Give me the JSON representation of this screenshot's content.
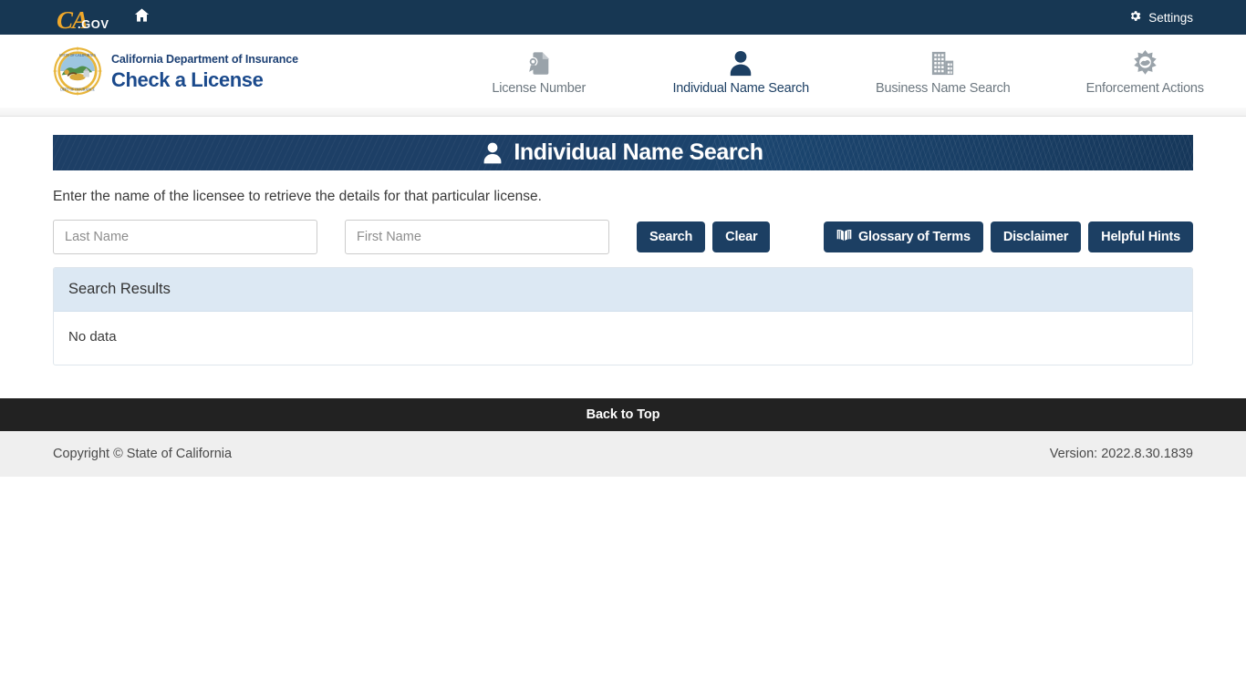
{
  "topbar": {
    "logo_mark": "CA",
    "logo_suffix": ".GOV",
    "home_icon": "home-icon",
    "settings_label": "Settings",
    "settings_icon": "gear-icon",
    "background": "#173753"
  },
  "brand": {
    "seal_icon": "california-state-seal",
    "department": "California Department of Insurance",
    "app_title": "Check a License"
  },
  "nav": {
    "items": [
      {
        "label": "License Number",
        "icon": "license-document-icon",
        "active": false
      },
      {
        "label": "Individual Name Search",
        "icon": "person-icon",
        "active": true
      },
      {
        "label": "Business Name Search",
        "icon": "buildings-icon",
        "active": false
      },
      {
        "label": "Enforcement Actions",
        "icon": "police-badge-star-icon",
        "active": false
      }
    ],
    "active_color": "#1c3f63",
    "inactive_color": "#6d7880"
  },
  "banner": {
    "title": "Individual Name Search",
    "icon": "person-icon",
    "background": "#1d3f66"
  },
  "main": {
    "intro": "Enter the name of the licensee to retrieve the details for that particular license.",
    "fields": {
      "last_name": {
        "placeholder": "Last Name",
        "value": ""
      },
      "first_name": {
        "placeholder": "First Name",
        "value": ""
      }
    },
    "buttons": {
      "search": "Search",
      "clear": "Clear",
      "glossary": "Glossary of Terms",
      "glossary_icon": "open-book-icon",
      "disclaimer": "Disclaimer",
      "helpful_hints": "Helpful Hints"
    },
    "results": {
      "heading": "Search Results",
      "empty_message": "No data"
    }
  },
  "footer": {
    "back_to_top": "Back to Top",
    "copyright": "Copyright © State of California",
    "version": "Version: 2022.8.30.1839"
  }
}
